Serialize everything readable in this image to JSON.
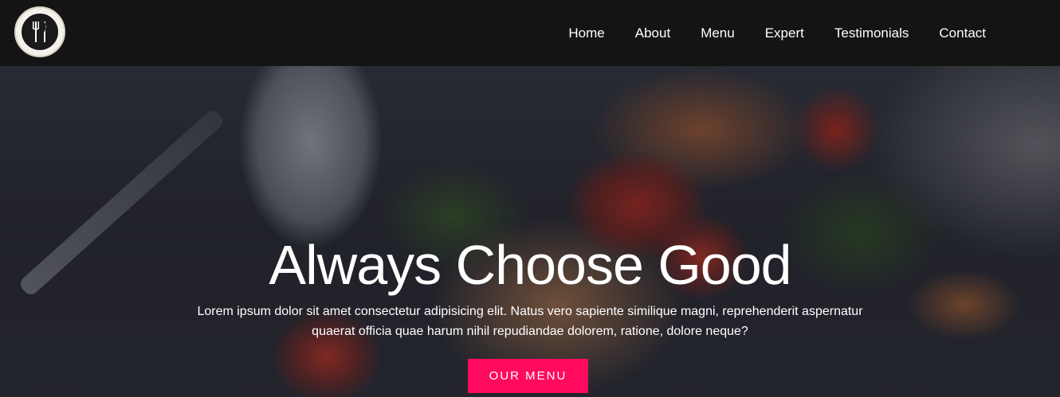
{
  "nav": {
    "logo_icon": "restaurant-fork-knife-logo",
    "links": [
      "Home",
      "About",
      "Menu",
      "Expert",
      "Testimonials",
      "Contact"
    ]
  },
  "hero": {
    "title": "Always Choose Good",
    "subtitle": "Lorem ipsum dolor sit amet consectetur adipisicing elit. Natus vero sapiente similique magni, reprehenderit aspernatur quaerat officia quae harum nihil repudiandae dolorem, ratione, dolore neque?",
    "cta_label": "OUR MENU"
  },
  "colors": {
    "navbar_bg": "#141414",
    "accent": "#ff0a5e",
    "text": "#ffffff"
  }
}
